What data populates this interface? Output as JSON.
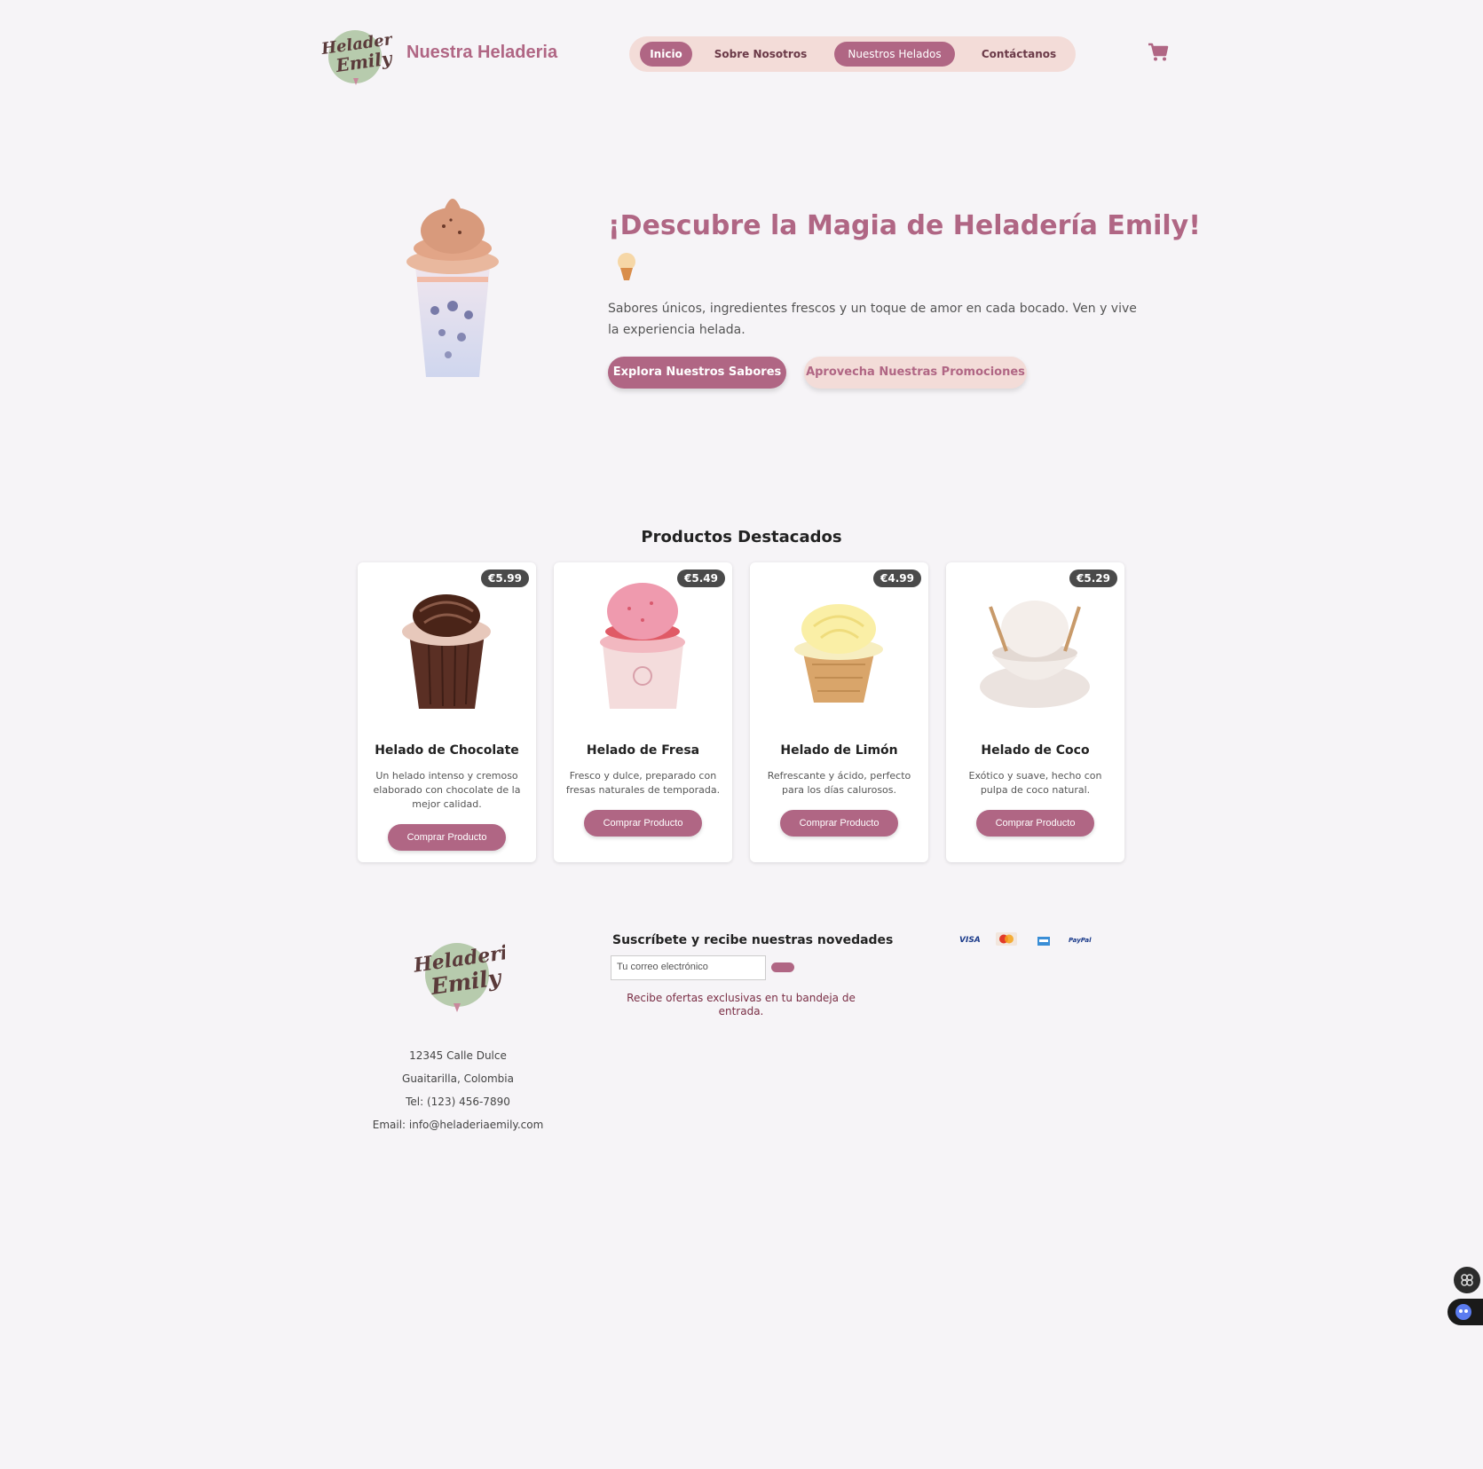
{
  "header": {
    "brand_title": "Nuestra Heladeria",
    "logo_text_line1": "Heladeria",
    "logo_text_line2": "Emily",
    "nav": [
      {
        "label": "Inicio",
        "active": true
      },
      {
        "label": "Sobre Nosotros",
        "active": false
      },
      {
        "label": "Nuestros Helados",
        "active": true
      },
      {
        "label": "Contáctanos",
        "active": false
      }
    ],
    "cart_icon": "cart-icon"
  },
  "hero": {
    "title": "¡Descubre la Magia de Heladería Emily!",
    "text": "Sabores únicos, ingredientes frescos y un toque de amor en cada bocado. Ven y vive la experiencia helada.",
    "primary_button": "Explora Nuestros Sabores",
    "secondary_button": "Aprovecha Nuestras Promociones"
  },
  "products": {
    "title": "Productos Destacados",
    "items": [
      {
        "name": "Helado de Chocolate",
        "price": "€5.99",
        "description": "Un helado intenso y cremoso elaborado con chocolate de la mejor calidad.",
        "button": "Comprar Producto"
      },
      {
        "name": "Helado de Fresa",
        "price": "€5.49",
        "description": "Fresco y dulce, preparado con fresas naturales de temporada.",
        "button": "Comprar Producto"
      },
      {
        "name": "Helado de Limón",
        "price": "€4.99",
        "description": "Refrescante y ácido, perfecto para los días calurosos.",
        "button": "Comprar Producto"
      },
      {
        "name": "Helado de Coco",
        "price": "€5.29",
        "description": "Exótico y suave, hecho con pulpa de coco natural.",
        "button": "Comprar Producto"
      }
    ]
  },
  "footer": {
    "address": [
      "12345 Calle Dulce",
      "Guaitarilla, Colombia",
      "Tel: (123) 456-7890",
      "Email: info@heladeriaemily.com"
    ],
    "newsletter_title": "Suscríbete y recibe nuestras novedades",
    "newsletter_placeholder": "Tu correo electrónico",
    "newsletter_note": "Recibe ofertas exclusivas en tu bandeja de entrada.",
    "payments": [
      "VISA",
      "mastercard",
      "amex",
      "PayPal"
    ]
  },
  "colors": {
    "brand": "#b06684",
    "nav_bg": "#f3dcd8",
    "page_bg": "#f6f4f7"
  }
}
